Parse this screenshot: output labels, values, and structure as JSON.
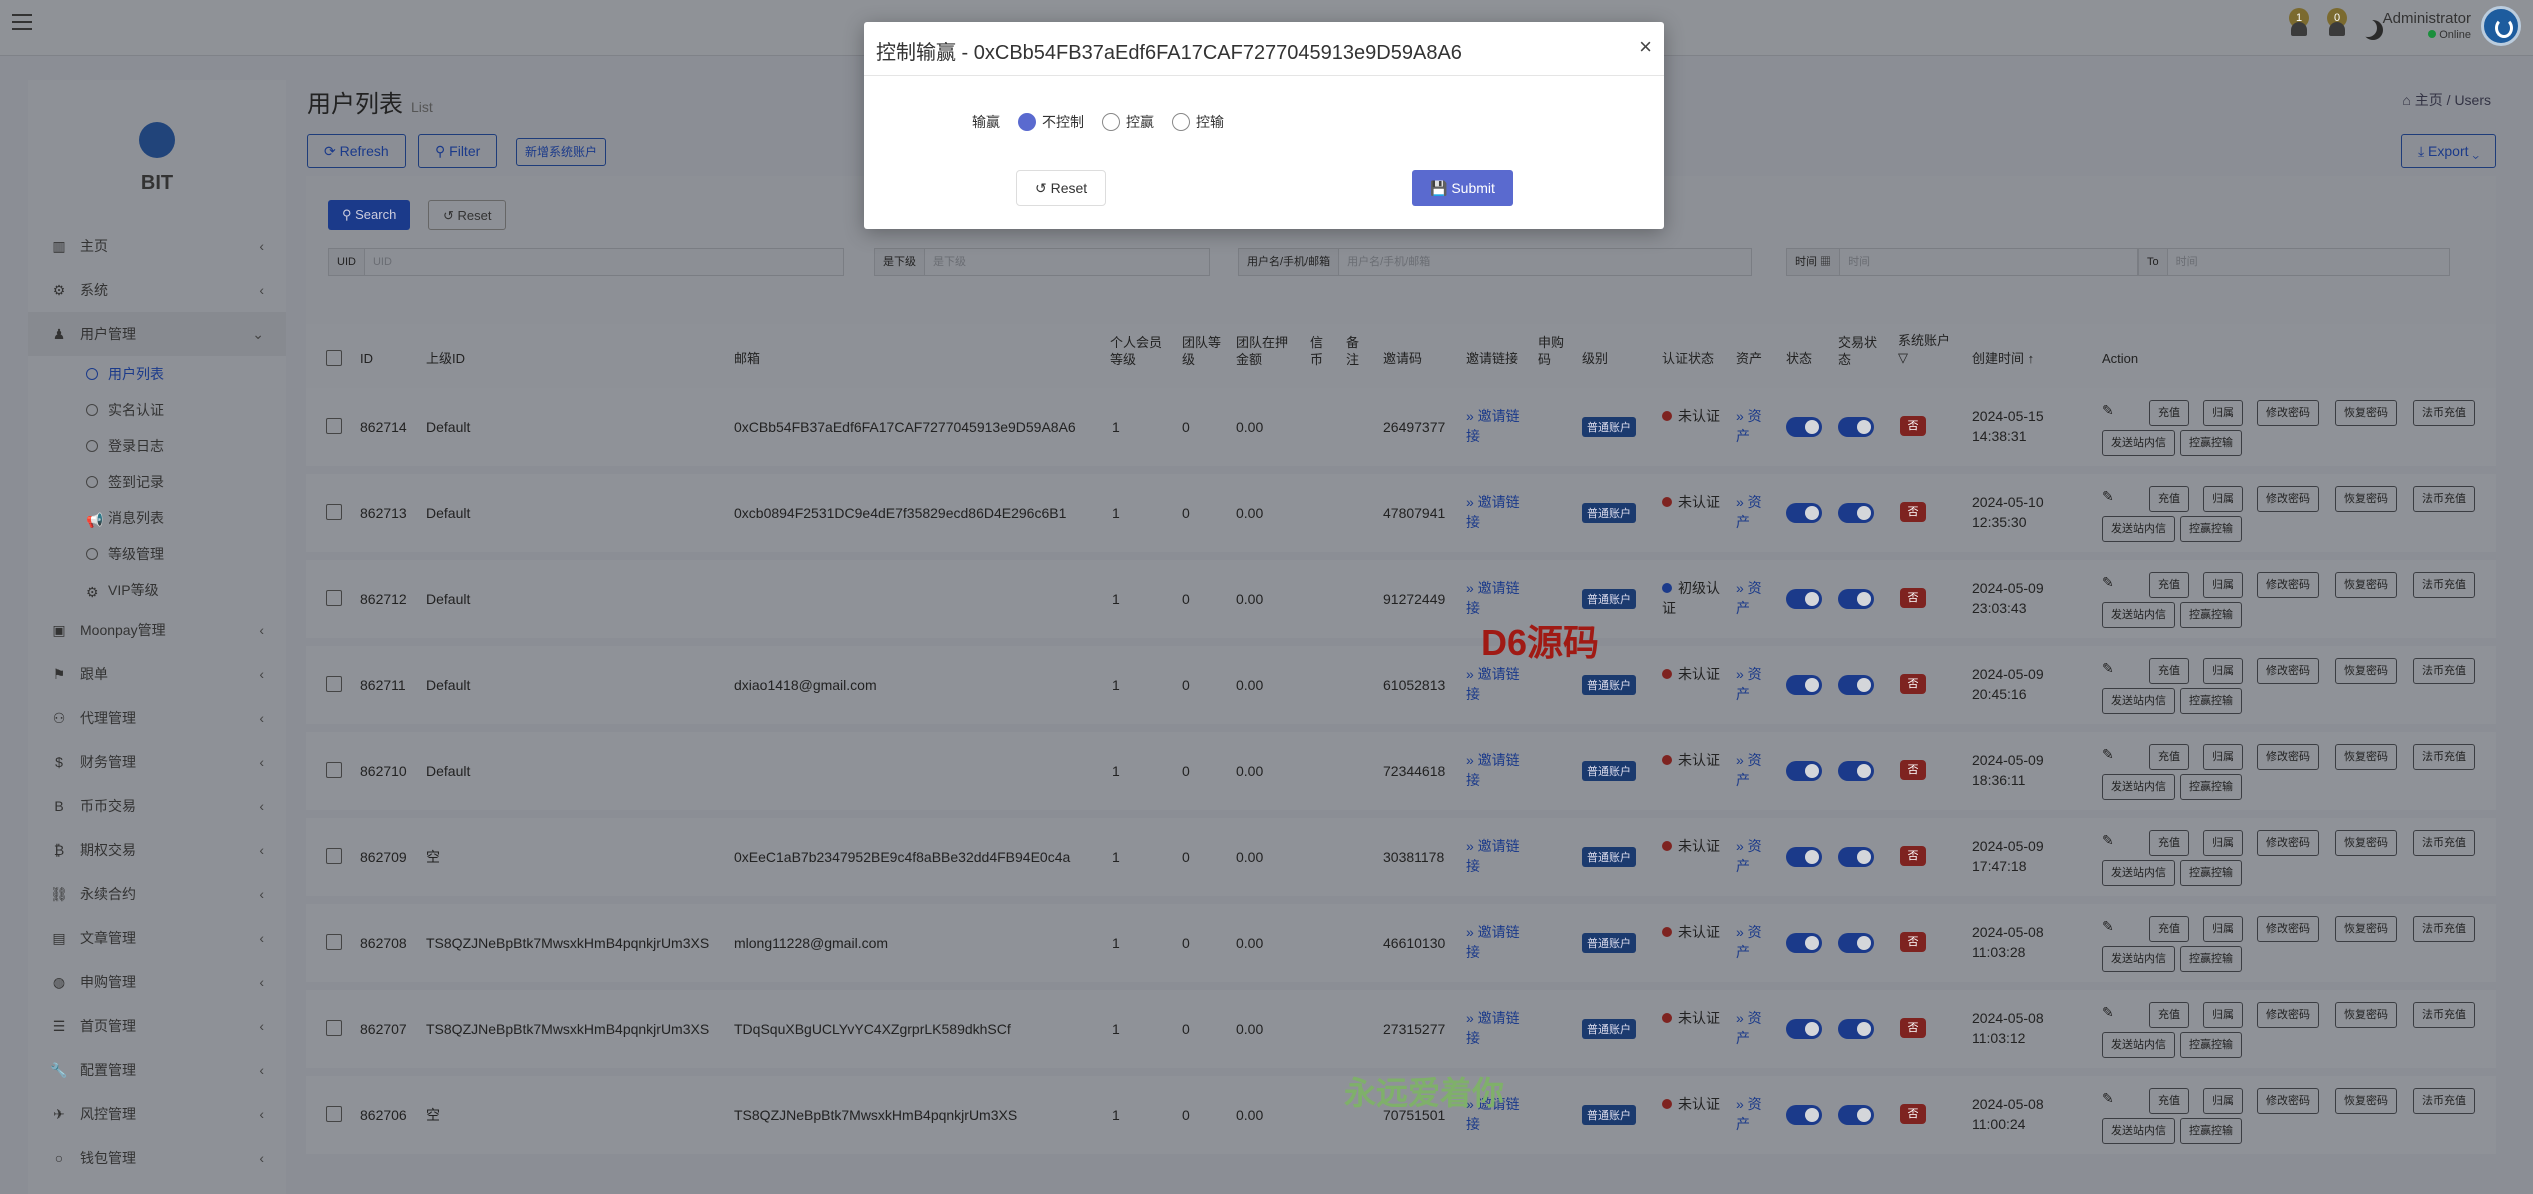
{
  "header": {
    "notif1_count": "1",
    "notif2_count": "0",
    "user_name": "Administrator",
    "user_status": "Online"
  },
  "sidebar": {
    "brand": "BIT",
    "items": [
      {
        "label": "主页",
        "icon": "chart-icon"
      },
      {
        "label": "系统",
        "icon": "gear-icon"
      },
      {
        "label": "用户管理",
        "icon": "user-icon"
      },
      {
        "label": "Moonpay管理",
        "icon": "card-icon"
      },
      {
        "label": "跟单",
        "icon": "flag-icon"
      },
      {
        "label": "代理管理",
        "icon": "users-icon"
      },
      {
        "label": "财务管理",
        "icon": "dollar-icon"
      },
      {
        "label": "币币交易",
        "icon": "bitcoin-icon"
      },
      {
        "label": "期权交易",
        "icon": "bitcoin-icon"
      },
      {
        "label": "永续合约",
        "icon": "link-icon"
      },
      {
        "label": "文章管理",
        "icon": "doc-icon"
      },
      {
        "label": "申购管理",
        "icon": "globe-icon"
      },
      {
        "label": "首页管理",
        "icon": "list-icon"
      },
      {
        "label": "配置管理",
        "icon": "wrench-icon"
      },
      {
        "label": "风控管理",
        "icon": "plane-icon"
      },
      {
        "label": "钱包管理",
        "icon": "circle-icon"
      }
    ],
    "subitems": [
      {
        "label": "用户列表"
      },
      {
        "label": "实名认证"
      },
      {
        "label": "登录日志"
      },
      {
        "label": "签到记录"
      },
      {
        "label": "消息列表"
      },
      {
        "label": "等级管理"
      },
      {
        "label": "VIP等级"
      }
    ]
  },
  "page": {
    "title": "用户列表",
    "subtitle": "List",
    "breadcrumb_home": "主页",
    "breadcrumb_current": "Users",
    "refresh": "Refresh",
    "filter": "Filter",
    "new_system_account": "新增系统账户",
    "export": "Export"
  },
  "filters": {
    "search": "Search",
    "reset": "Reset",
    "uid_label": "UID",
    "uid_placeholder": "UID",
    "sub_label": "是下级",
    "sub_placeholder": "是下级",
    "user_label": "用户名/手机/邮箱",
    "user_placeholder": "用户名/手机/邮箱",
    "time_label": "时间",
    "time_placeholder": "时间",
    "to_label": "To",
    "to_placeholder": "时间"
  },
  "table": {
    "headers": {
      "id": "ID",
      "parent": "上级ID",
      "email": "邮箱",
      "personal_level": "个人会员等级",
      "team_level": "团队等级",
      "team_pledge": "团队在押金额",
      "credit": "信币",
      "remark": "备注",
      "invite_code": "邀请码",
      "invite_link": "邀请链接",
      "subscribe": "申购码",
      "level": "级别",
      "kyc": "认证状态",
      "assets": "资产",
      "status": "状态",
      "trade_status": "交易状态",
      "system_account": "系统账户",
      "created": "创建时间",
      "action": "Action"
    },
    "rows": [
      {
        "id": "862714",
        "parent": "Default",
        "email": "0xCBb54FB37aEdf6FA17CAF7277045913e9D59A8A6",
        "level": "1",
        "team": "0",
        "pledge": "0.00",
        "code": "26497377",
        "link": "» 邀请链接",
        "account": "普通账户",
        "kyc": "未认证",
        "assets": "» 资产",
        "sys": "否",
        "date": "2024-05-15",
        "time": "14:38:31"
      },
      {
        "id": "862713",
        "parent": "Default",
        "email": "0xcb0894F2531DC9e4dE7f35829ecd86D4E296c6B1",
        "level": "1",
        "team": "0",
        "pledge": "0.00",
        "code": "47807941",
        "link": "» 邀请链接",
        "account": "普通账户",
        "kyc": "未认证",
        "assets": "» 资产",
        "sys": "否",
        "date": "2024-05-10",
        "time": "12:35:30"
      },
      {
        "id": "862712",
        "parent": "Default",
        "email": "",
        "level": "1",
        "team": "0",
        "pledge": "0.00",
        "code": "91272449",
        "link": "» 邀请链接",
        "account": "普通账户",
        "kyc": "初级认证",
        "assets": "» 资产",
        "sys": "否",
        "date": "2024-05-09",
        "time": "23:03:43"
      },
      {
        "id": "862711",
        "parent": "Default",
        "email": "dxiao1418@gmail.com",
        "level": "1",
        "team": "0",
        "pledge": "0.00",
        "code": "61052813",
        "link": "» 邀请链接",
        "account": "普通账户",
        "kyc": "未认证",
        "assets": "» 资产",
        "sys": "否",
        "date": "2024-05-09",
        "time": "20:45:16"
      },
      {
        "id": "862710",
        "parent": "Default",
        "email": "",
        "level": "1",
        "team": "0",
        "pledge": "0.00",
        "code": "72344618",
        "link": "» 邀请链接",
        "account": "普通账户",
        "kyc": "未认证",
        "assets": "» 资产",
        "sys": "否",
        "date": "2024-05-09",
        "time": "18:36:11"
      },
      {
        "id": "862709",
        "parent": "空",
        "email": "0xEeC1aB7b2347952BE9c4f8aBBe32dd4FB94E0c4a",
        "level": "1",
        "team": "0",
        "pledge": "0.00",
        "code": "30381178",
        "link": "» 邀请链接",
        "account": "普通账户",
        "kyc": "未认证",
        "assets": "» 资产",
        "sys": "否",
        "date": "2024-05-09",
        "time": "17:47:18"
      },
      {
        "id": "862708",
        "parent": "TS8QZJNeBpBtk7MwsxkHmB4pqnkjrUm3XS",
        "email": "mlong11228@gmail.com",
        "level": "1",
        "team": "0",
        "pledge": "0.00",
        "code": "46610130",
        "link": "» 邀请链接",
        "account": "普通账户",
        "kyc": "未认证",
        "assets": "» 资产",
        "sys": "否",
        "date": "2024-05-08",
        "time": "11:03:28"
      },
      {
        "id": "862707",
        "parent": "TS8QZJNeBpBtk7MwsxkHmB4pqnkjrUm3XS",
        "email": "TDqSquXBgUCLYvYC4XZgrprLK589dkhSCf",
        "level": "1",
        "team": "0",
        "pledge": "0.00",
        "code": "27315277",
        "link": "» 邀请链接",
        "account": "普通账户",
        "kyc": "未认证",
        "assets": "» 资产",
        "sys": "否",
        "date": "2024-05-08",
        "time": "11:03:12"
      },
      {
        "id": "862706",
        "parent": "空",
        "email": "TS8QZJNeBpBtk7MwsxkHmB4pqnkjrUm3XS",
        "level": "1",
        "team": "0",
        "pledge": "0.00",
        "code": "70751501",
        "link": "» 邀请链接",
        "account": "普通账户",
        "kyc": "未认证",
        "assets": "» 资产",
        "sys": "否",
        "date": "2024-05-08",
        "time": "11:00:24"
      }
    ],
    "actions": {
      "recharge": "充值",
      "belong": "归属",
      "change_pwd": "修改密码",
      "restore_pwd": "恢复密码",
      "fiat_recharge": "法币充值",
      "send_msg": "发送站内信",
      "control": "控赢控输"
    }
  },
  "watermarks": {
    "top": "D6源码",
    "bottom": "永远爱着你"
  },
  "modal": {
    "title": "控制输赢 - 0xCBb54FB37aEdf6FA17CAF7277045913e9D59A8A6",
    "close": "×",
    "field_label": "输赢",
    "options": [
      "不控制",
      "控赢",
      "控输"
    ],
    "selected": "不控制",
    "reset": "Reset",
    "submit": "Submit"
  },
  "colors": {
    "primary": "#5a6acf",
    "danger": "#7e2320",
    "backdrop": "#8b8e95"
  }
}
